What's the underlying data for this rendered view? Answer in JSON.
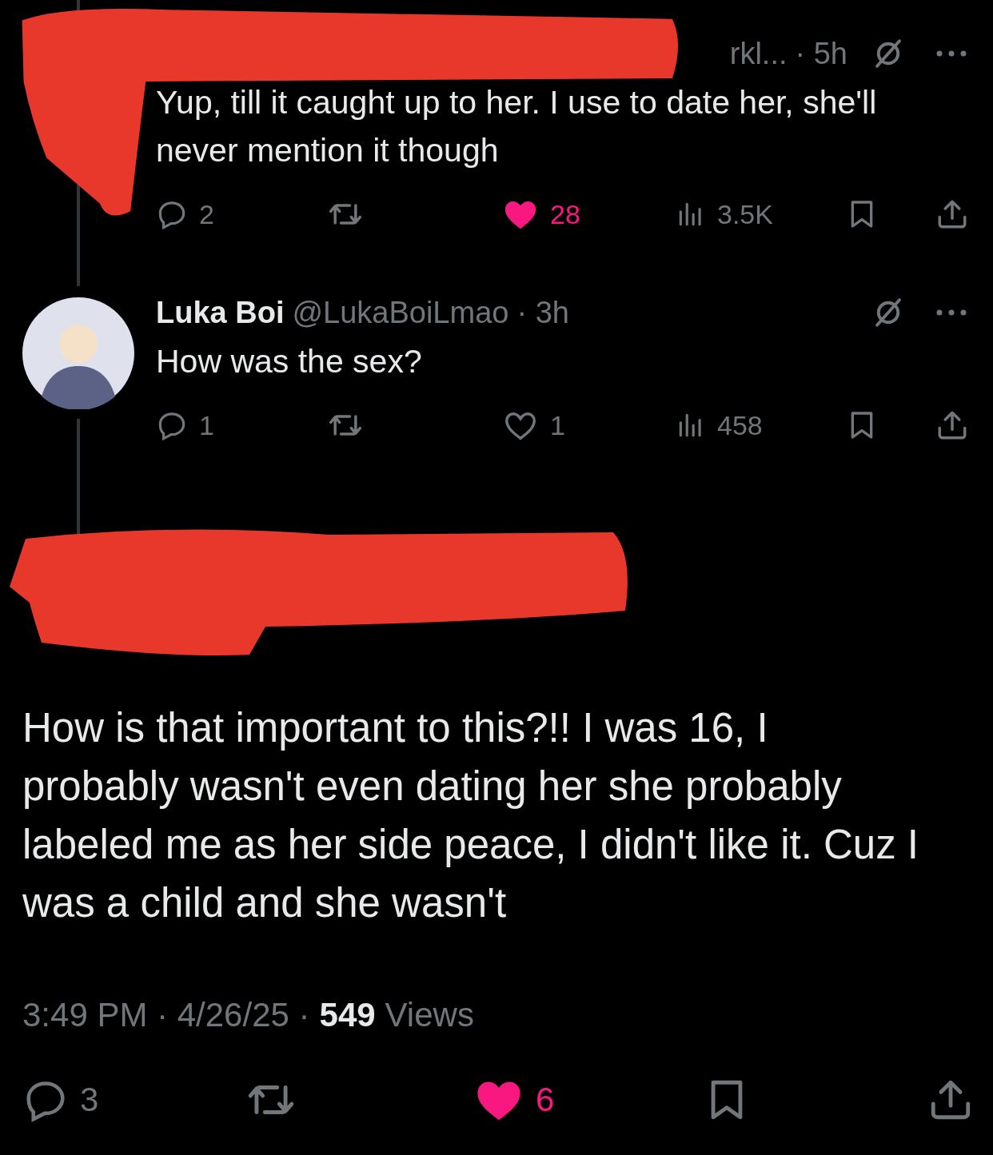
{
  "thread": [
    {
      "kind": "redacted",
      "handle": "rkl...",
      "time": "· 5h",
      "text": "Yup, till it caught up to her. I use to date her, she'll never mention it though",
      "actions": {
        "replies": "2",
        "likes": "28",
        "liked": true,
        "views": "3.5K"
      }
    },
    {
      "kind": "user",
      "name": "Luka Boi",
      "handle": "@LukaBoiLmao",
      "time": "· 3h",
      "text": "How was the sex?",
      "actions": {
        "replies": "1",
        "likes": "1",
        "liked": false,
        "views": "458"
      }
    }
  ],
  "main": {
    "author_redacted": true,
    "text": "How is that important to this?!! I was 16, I probably wasn't even dating her she probably labeled me as her side peace, I didn't like it. Cuz I was a child and she wasn't",
    "timestamp": "3:49 PM · 4/26/25 ·",
    "views_count": "549",
    "views_label": "Views",
    "actions": {
      "replies": "3",
      "likes": "6",
      "liked": true
    }
  }
}
